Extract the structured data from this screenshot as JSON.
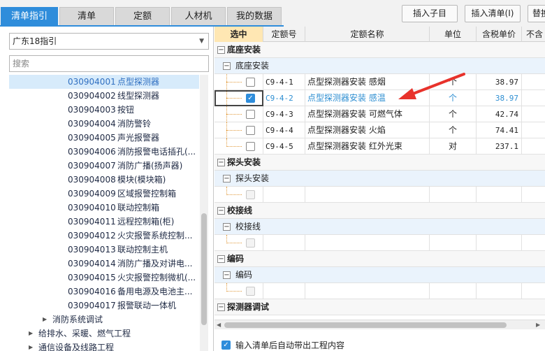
{
  "tabs": [
    {
      "label": "清单指引",
      "active": true
    },
    {
      "label": "清单",
      "active": false
    },
    {
      "label": "定额",
      "active": false
    },
    {
      "label": "人材机",
      "active": false
    },
    {
      "label": "我的数据",
      "active": false
    }
  ],
  "toolbar": {
    "insert_child": "插入子目",
    "insert_list": "插入清单(I)",
    "replace": "替换"
  },
  "left": {
    "guide_select": "广东18指引",
    "search_placeholder": "搜索",
    "items": [
      {
        "code": "030904001",
        "name": "点型探测器"
      },
      {
        "code": "030904002",
        "name": "线型探测器"
      },
      {
        "code": "030904003",
        "name": "按钮"
      },
      {
        "code": "030904004",
        "name": "消防警铃"
      },
      {
        "code": "030904005",
        "name": "声光报警器"
      },
      {
        "code": "030904006",
        "name": "消防报警电话插孔(..."
      },
      {
        "code": "030904007",
        "name": "消防广播(扬声器)"
      },
      {
        "code": "030904008",
        "name": "模块(模块箱)"
      },
      {
        "code": "030904009",
        "name": "区域报警控制箱"
      },
      {
        "code": "030904010",
        "name": "联动控制箱"
      },
      {
        "code": "030904011",
        "name": "远程控制箱(柜)"
      },
      {
        "code": "030904012",
        "name": "火灾报警系统控制..."
      },
      {
        "code": "030904013",
        "name": "联动控制主机"
      },
      {
        "code": "030904014",
        "name": "消防广播及对讲电..."
      },
      {
        "code": "030904015",
        "name": "火灾报警控制微机(..."
      },
      {
        "code": "030904016",
        "name": "备用电源及电池主..."
      },
      {
        "code": "030904017",
        "name": "报警联动一体机"
      }
    ],
    "groups": [
      "消防系统调试",
      "给排水、采暖、燃气工程",
      "通信设备及线路工程"
    ]
  },
  "grid": {
    "headers": {
      "select": "选中",
      "code": "定额号",
      "name": "定额名称",
      "unit": "单位",
      "price": "含税单价",
      "extra": "不含"
    },
    "section1": {
      "title": "底座安装",
      "sub": "底座安装"
    },
    "rows": [
      {
        "code": "C9-4-1",
        "name": "点型探测器安装 感烟",
        "unit": "个",
        "price": "38.97",
        "checked": false
      },
      {
        "code": "C9-4-2",
        "name": "点型探测器安装 感温",
        "unit": "个",
        "price": "38.97",
        "checked": true
      },
      {
        "code": "C9-4-3",
        "name": "点型探测器安装 可燃气体",
        "unit": "个",
        "price": "42.74",
        "checked": false
      },
      {
        "code": "C9-4-4",
        "name": "点型探测器安装 火焰",
        "unit": "个",
        "price": "74.41",
        "checked": false
      },
      {
        "code": "C9-4-5",
        "name": "点型探测器安装 红外光束",
        "unit": "对",
        "price": "237.1",
        "checked": false
      }
    ],
    "section2": {
      "title": "探头安装",
      "sub": "探头安装"
    },
    "section3": {
      "title": "校接线",
      "sub": "校接线"
    },
    "section4": {
      "title": "编码",
      "sub": "编码"
    },
    "section5": {
      "title": "探测器调试"
    }
  },
  "footer": {
    "auto_label": "输入清单后自动带出工程内容"
  },
  "colors": {
    "accent": "#2f8ddb",
    "arrow": "#e8322b",
    "selected_text": "#2f8fd2"
  }
}
